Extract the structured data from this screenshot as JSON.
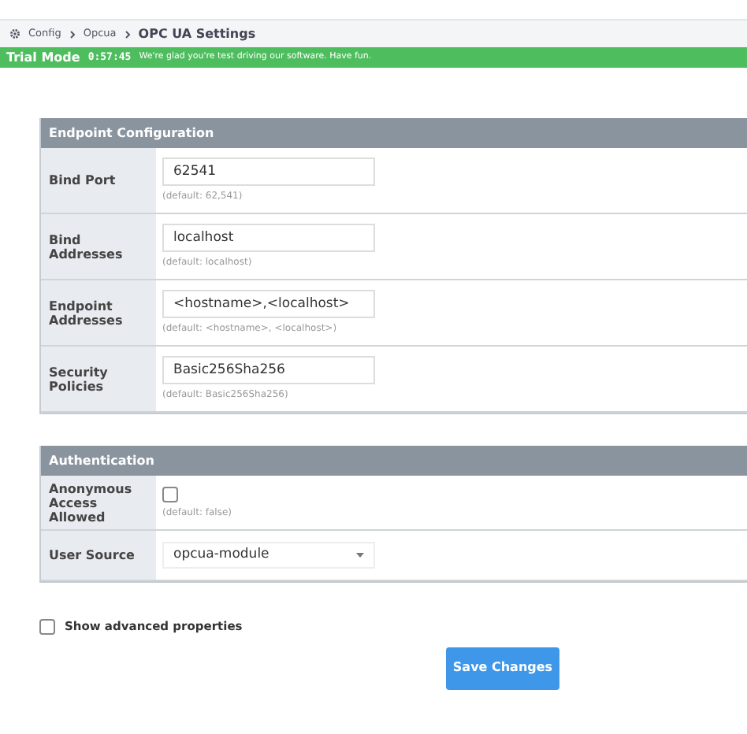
{
  "breadcrumb": {
    "items": [
      "Config",
      "Opcua"
    ],
    "current": "OPC UA Settings"
  },
  "trial_banner": {
    "title": "Trial Mode",
    "time": "0:57:45",
    "message": "We're glad you're test driving our software. Have fun."
  },
  "sections": [
    {
      "title": "Endpoint Configuration",
      "fields": [
        {
          "kind": "text",
          "label": "Bind Port",
          "value": "62541",
          "hint": "(default: 62,541)"
        },
        {
          "kind": "text",
          "label": "Bind Addresses",
          "value": "localhost",
          "hint": "(default: localhost)"
        },
        {
          "kind": "text",
          "label": "Endpoint Addresses",
          "value": "<hostname>,<localhost>",
          "hint": "(default: <hostname>, <localhost>)"
        },
        {
          "kind": "text",
          "label": "Security Policies",
          "value": "Basic256Sha256",
          "hint": "(default: Basic256Sha256)"
        }
      ]
    },
    {
      "title": "Authentication",
      "fields": [
        {
          "kind": "checkbox",
          "label": "Anonymous Access Allowed",
          "checked": false,
          "hint": "(default: false)"
        },
        {
          "kind": "select",
          "label": "User Source",
          "value": "opcua-module"
        }
      ]
    }
  ],
  "show_advanced": {
    "label": "Show advanced properties",
    "checked": false
  },
  "save_button": "Save Changes"
}
